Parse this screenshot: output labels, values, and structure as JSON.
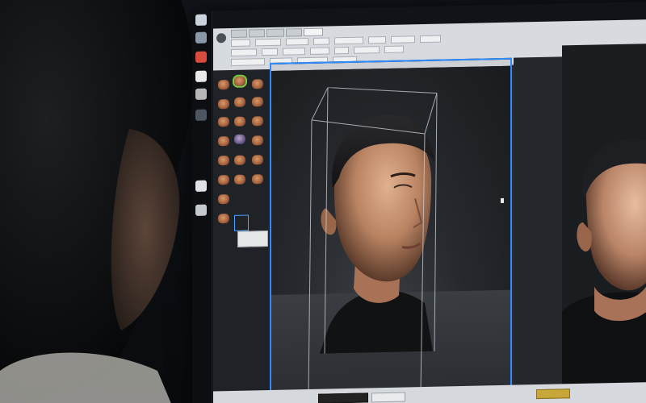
{
  "scene": {
    "kind": "photo of a person viewing a 3D face scan on a monitor"
  },
  "colors": {
    "viewport_border": "#2f8cff",
    "selected_thumbnail": "#7ac943",
    "toolbar": "#d7dade",
    "app_background": "#2a2d31"
  },
  "icons": [
    "app-logo-icon"
  ],
  "thumbnails": {
    "count": 20,
    "selected_index": 1
  }
}
